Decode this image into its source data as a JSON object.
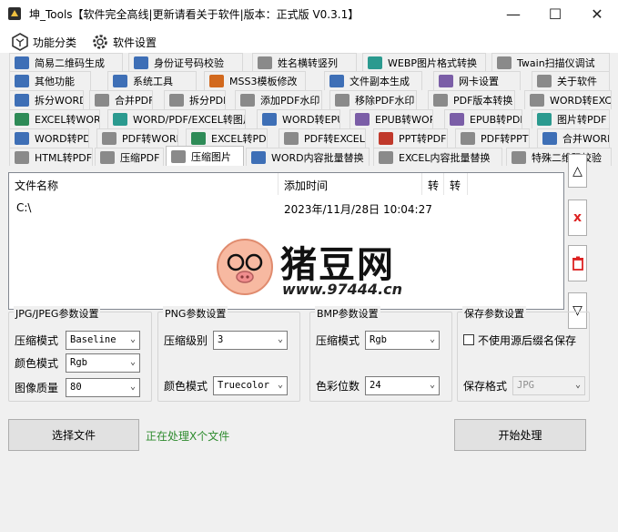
{
  "window": {
    "title": "坤_Tools【软件完全高线|更新请看关于软件|版本：正式版 V0.3.1】",
    "min_label": "—",
    "max_label": "☐",
    "close_label": "✕"
  },
  "menubar": {
    "items": [
      {
        "label": "功能分类",
        "icon": "hexagon-icon"
      },
      {
        "label": "软件设置",
        "icon": "gear-icon"
      }
    ]
  },
  "tabs": {
    "row1": [
      "简易二维码生成",
      "身份证号码校验",
      "姓名横转竖列",
      "WEBP图片格式转换",
      "Twain扫描仪调试"
    ],
    "row2": [
      "其他功能",
      "系统工具",
      "MSS3模板修改",
      "文件副本生成",
      "网卡设置",
      "关于软件"
    ],
    "row3": [
      "拆分WORD",
      "合并PDF",
      "拆分PDF",
      "添加PDF水印",
      "移除PDF水印",
      "PDF版本转换",
      "WORD转EXCEL"
    ],
    "row4": [
      "EXCEL转WORD",
      "WORD/PDF/EXCEL转图片",
      "WORD转EPUB",
      "EPUB转WORD",
      "EPUB转PDF",
      "图片转PDF"
    ],
    "row5": [
      "WORD转PDF",
      "PDF转WORD",
      "EXCEL转PDF",
      "PDF转EXCEL",
      "PPT转PDF",
      "PDF转PPT",
      "合并WORD"
    ],
    "row6": [
      "HTML转PDF",
      "压缩PDF",
      "压缩图片",
      "WORD内容批量替换",
      "EXCEL内容批量替换",
      "特殊二维码校验"
    ],
    "active": "压缩图片"
  },
  "file_list": {
    "columns": [
      "文件名称",
      "添加时间",
      "转",
      "转"
    ],
    "rows": [
      {
        "name": "C:\\",
        "time": "2023年/11月/28日  10:04:27"
      }
    ]
  },
  "side_buttons": {
    "up_label": "△",
    "delete_label": "x",
    "clear_label": "🗑",
    "down_label": "▽"
  },
  "jpg_group": {
    "title": "JPG/JPEG参数设置",
    "mode_label": "压缩模式",
    "mode_value": "Baseline",
    "color_label": "颜色模式",
    "color_value": "Rgb",
    "quality_label": "图像质量",
    "quality_value": "80"
  },
  "png_group": {
    "title": "PNG参数设置",
    "level_label": "压缩级别",
    "level_value": "3",
    "color_label": "颜色模式",
    "color_value": "Truecolor"
  },
  "bmp_group": {
    "title": "BMP参数设置",
    "mode_label": "压缩模式",
    "mode_value": "Rgb",
    "depth_label": "色彩位数",
    "depth_value": "24"
  },
  "save_group": {
    "title": "保存参数设置",
    "checkbox_label": "不使用源后缀名保存",
    "format_label": "保存格式",
    "format_value": "JPG"
  },
  "actions": {
    "select_label": "选择文件",
    "status_text": "正在处理X个文件",
    "start_label": "开始处理"
  },
  "watermark": {
    "brand": "猪豆网",
    "url": "www.97444.cn"
  }
}
